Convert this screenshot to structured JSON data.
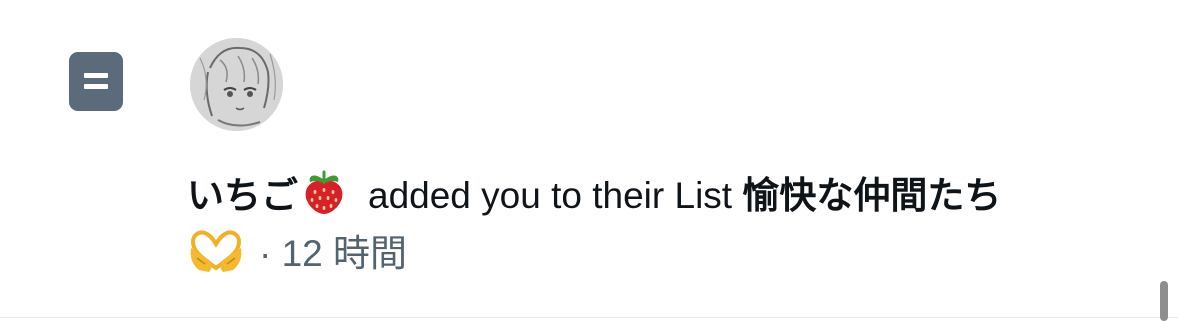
{
  "notification": {
    "user_name": "いちご",
    "action_text": "added you to their List",
    "list_name": "愉快な仲間たち",
    "time_separator": "·",
    "time_ago": "12 時間",
    "icons": [
      "list-icon",
      "strawberry-emoji",
      "heart-hands-emoji"
    ]
  },
  "colors": {
    "list_icon_bg": "#5b6b7b",
    "text_primary": "#0f1419",
    "text_secondary": "#536471"
  }
}
